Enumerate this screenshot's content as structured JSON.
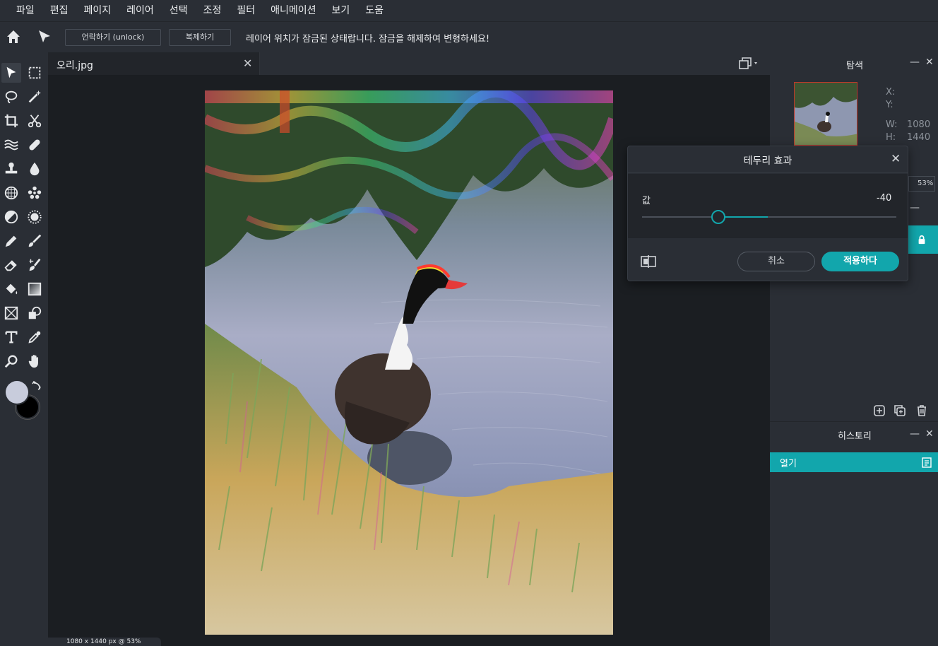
{
  "menu": [
    "파일",
    "편집",
    "페이지",
    "레이어",
    "선택",
    "조정",
    "필터",
    "애니메이션",
    "보기",
    "도움"
  ],
  "options": {
    "unlock_label": "언락하기 (unlock)",
    "duplicate_label": "복제하기",
    "lock_message": "레이어 위치가 잠금된 상태랍니다. 잠금을 해제하여 변형하세요!"
  },
  "document": {
    "tab_name": "오리.jpg",
    "close_glyph": "✕",
    "status": "1080 x 1440 px @ 53%"
  },
  "navigator": {
    "title": "탐색",
    "x_label": "X:",
    "y_label": "Y:",
    "w_label": "W:",
    "w_value": "1080",
    "h_label": "H:",
    "h_value": "1440",
    "zoom": "53%"
  },
  "history": {
    "title": "히스토리",
    "items": [
      "열기"
    ]
  },
  "dialog": {
    "title": "테두리 효과",
    "value_label": "값",
    "value": "-40",
    "slider_fraction": 0.3,
    "cancel_label": "취소",
    "apply_label": "적용하다"
  },
  "colors": {
    "accent": "#12a6ac",
    "foreground_color": "#c8ccdc",
    "background_color": "#000000"
  }
}
